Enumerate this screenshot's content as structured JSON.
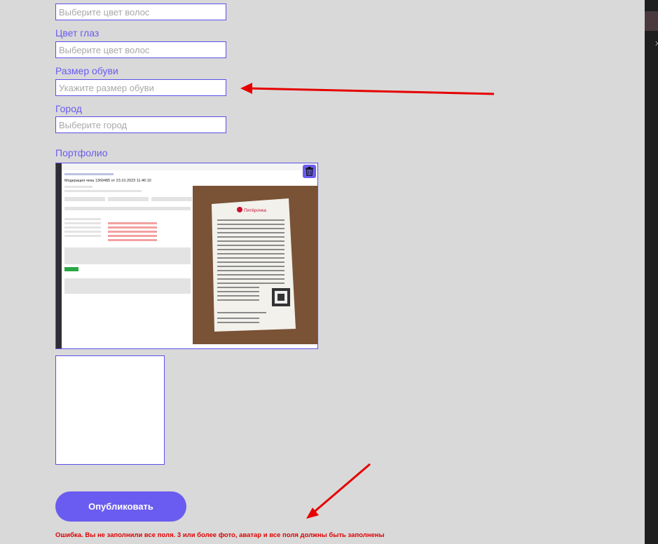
{
  "form": {
    "hair_field": {
      "placeholder": "Выберите цвет волос"
    },
    "eye_label": "Цвет глаз",
    "eye_field": {
      "placeholder": "Выберите цвет волос"
    },
    "shoe_label": "Размер обуви",
    "shoe_field": {
      "placeholder": "Укажите размер обуви"
    },
    "city_label": "Город",
    "city_field": {
      "placeholder": "Выберите город"
    }
  },
  "portfolio": {
    "label": "Портфолио",
    "photo": {
      "page_title": "Модерация чека 1369485 от 23.10.2023 11:46:10",
      "receipt_store": "Пятёрочка",
      "delete_icon": "trash-icon"
    }
  },
  "publish_label": "Опубликовать",
  "error_text": "Ошибка. Вы не заполнили все поля. 3 или более фото, аватар и все поля должны быть заполнены",
  "colors": {
    "accent": "#6a5cf0",
    "error": "#e00000",
    "arrow": "#e60000",
    "background": "#d9d9d9"
  }
}
